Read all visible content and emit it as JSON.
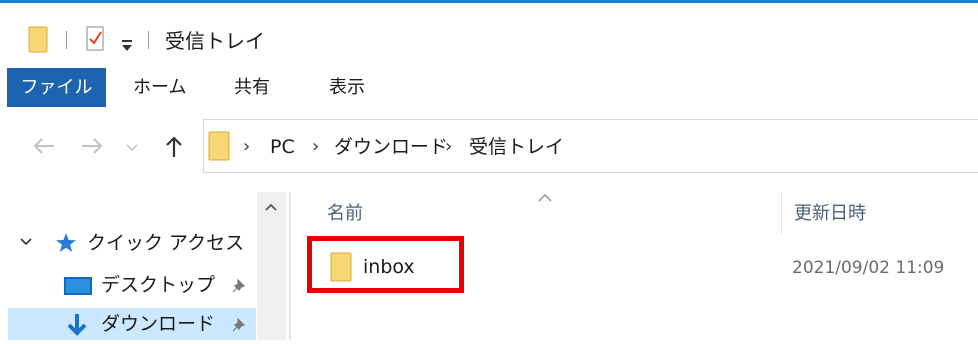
{
  "window": {
    "title": "受信トレイ"
  },
  "ribbon": {
    "tabs": [
      {
        "label": "ファイル",
        "active": true
      },
      {
        "label": "ホーム",
        "active": false
      },
      {
        "label": "共有",
        "active": false
      },
      {
        "label": "表示",
        "active": false
      }
    ]
  },
  "address_bar": {
    "path": [
      "PC",
      "ダウンロード",
      "受信トレイ"
    ]
  },
  "navigation_pane": {
    "quick_access": {
      "label": "クイック アクセス",
      "expanded": true
    },
    "items": [
      {
        "label": "デスクトップ",
        "pinned": true,
        "icon": "desktop-icon"
      },
      {
        "label": "ダウンロード",
        "pinned": true,
        "icon": "download-icon",
        "selected": true
      }
    ]
  },
  "file_list": {
    "columns": {
      "name": "名前",
      "modified": "更新日時"
    },
    "sort_column": "名前",
    "rows": [
      {
        "name": "inbox",
        "type": "folder",
        "modified": "2021/09/02 11:09",
        "highlighted": true
      }
    ]
  },
  "colors": {
    "accent": "#1883d7",
    "file_tab": "#1c64b1",
    "selection": "#cce8ff",
    "highlight_box": "#e80000",
    "folder": "#f8d775"
  }
}
